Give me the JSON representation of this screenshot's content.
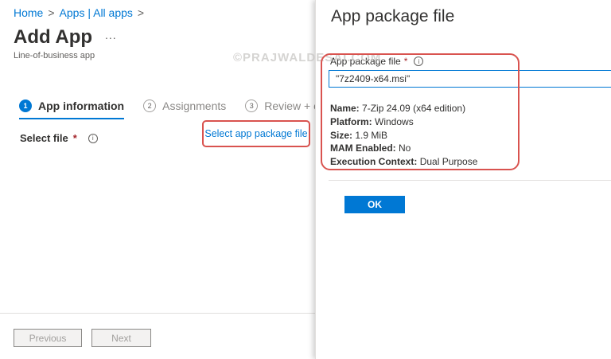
{
  "breadcrumb": {
    "home": "Home",
    "apps": "Apps | All apps",
    "sep1": ">",
    "sep2": ">"
  },
  "page": {
    "title": "Add App",
    "more": "...",
    "subtitle": "Line-of-business app"
  },
  "steps": [
    {
      "num": "1",
      "label": "App information",
      "active": true
    },
    {
      "num": "2",
      "label": "Assignments",
      "active": false
    },
    {
      "num": "3",
      "label": "Review + cre",
      "active": false
    }
  ],
  "select_file": {
    "label": "Select file",
    "required_mark": "*",
    "info": "i",
    "link": "Select app package file"
  },
  "footer": {
    "previous": "Previous",
    "next": "Next"
  },
  "blade": {
    "title": "App package file",
    "watermark": "©PRAJWALDESAI.COM",
    "field_label": "App package file",
    "required_mark": "*",
    "info": "i",
    "field_value": "\"7z2409-x64.msi\"",
    "props": [
      {
        "key": "Name:",
        "value": "7-Zip 24.09 (x64 edition)"
      },
      {
        "key": "Platform:",
        "value": "Windows"
      },
      {
        "key": "Size:",
        "value": "1.9 MiB"
      },
      {
        "key": "MAM Enabled:",
        "value": "No"
      },
      {
        "key": "Execution Context:",
        "value": "Dual Purpose"
      }
    ],
    "ok": "OK"
  },
  "colors": {
    "accent": "#0078d4",
    "highlight": "#d9534f",
    "required": "#a4262c"
  }
}
